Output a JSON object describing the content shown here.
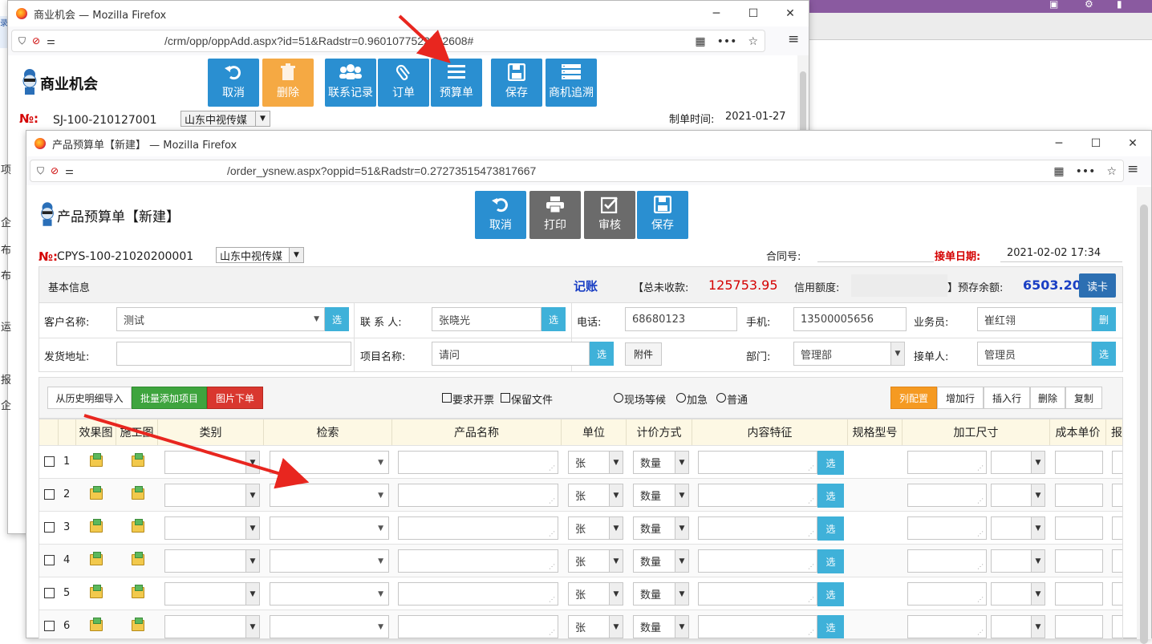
{
  "back_window": {
    "title": "商业机会 — Mozilla Firefox",
    "url": "/crm/opp/oppAdd.aspx?id=51&Radstr=0.9601077522582608#",
    "logo_text": "商业机会",
    "toolbar": [
      {
        "label": "取消",
        "icon": "undo-icon",
        "color": "#2a8fd1"
      },
      {
        "label": "删除",
        "icon": "trash-icon",
        "color": "#f5a943"
      },
      {
        "label": "联系记录",
        "icon": "users-icon",
        "color": "#2a8fd1"
      },
      {
        "label": "订单",
        "icon": "paperclip-icon",
        "color": "#2a8fd1"
      },
      {
        "label": "预算单",
        "icon": "list-icon",
        "color": "#2a8fd1"
      },
      {
        "label": "保存",
        "icon": "floppy-icon",
        "color": "#2a8fd1"
      },
      {
        "label": "商机追溯",
        "icon": "server-icon",
        "color": "#2a8fd1"
      }
    ],
    "no_label": "№:",
    "no_value": "SJ-100-210127001",
    "company": "山东中视传媒",
    "date_label": "制单时间:",
    "date_value": "2021-01-27",
    "left_edge_chars": [
      "项",
      "企",
      "布",
      "布",
      "运",
      "报",
      "企"
    ]
  },
  "front_window": {
    "title": "产品预算单【新建】 — Mozilla Firefox",
    "url": "/order_ysnew.aspx?oppid=51&Radstr=0.27273515473817667",
    "logo_text": "产品预算单【新建】",
    "toolbar": [
      {
        "label": "取消",
        "icon": "undo-icon",
        "color": "#2a8fd1"
      },
      {
        "label": "打印",
        "icon": "printer-icon",
        "color": "#6b6b6b"
      },
      {
        "label": "审核",
        "icon": "check-icon",
        "color": "#6b6b6b"
      },
      {
        "label": "保存",
        "icon": "floppy-icon",
        "color": "#2a8fd1"
      }
    ],
    "no_label": "№:",
    "no_value": "CPYS-100-21020200001",
    "company": "山东中视传媒",
    "contract_label": "合同号:",
    "contract_value": "",
    "receive_date_label": "接单日期:",
    "receive_date_value": "2021-02-02 17:34",
    "info": {
      "basic_label": "基本信息",
      "account_label": "记账",
      "total_unreceived_label": "【总未收款:",
      "total_unreceived_value": "125753.95",
      "credit_label": "信用额度:",
      "credit_value": "",
      "prepay_label": "】预存余额:",
      "prepay_value": "6503.20",
      "read_card_label": "读卡"
    },
    "form": {
      "customer_label": "客户名称:",
      "customer_value": "测试",
      "contact_label": "联 系 人:",
      "contact_value": "张晓光",
      "phone_label": "电话:",
      "phone_value": "68680123",
      "mobile_label": "手机:",
      "mobile_value": "13500005656",
      "sales_label": "业务员:",
      "sales_value": "崔红翎",
      "address_label": "发货地址:",
      "address_value": "",
      "project_label": "项目名称:",
      "project_value": "请问",
      "attach_label": "附件",
      "dept_label": "部门:",
      "dept_value": "管理部",
      "receiver_label": "接单人:",
      "receiver_value": "管理员",
      "select_label": "选",
      "delete_label": "删"
    },
    "actions": {
      "import_history": "从历史明细导入",
      "batch_add": "批量添加项目",
      "image_order": "图片下单",
      "need_invoice": "要求开票",
      "keep_file": "保留文件",
      "onsite_wait": "现场等候",
      "urgent": "加急",
      "normal": "普通",
      "column_config": "列配置",
      "add_row": "增加行",
      "insert_row": "插入行",
      "delete_row": "删除",
      "copy_row": "复制"
    },
    "columns": [
      "效果图",
      "施工图",
      "类别",
      "检索",
      "产品名称",
      "单位",
      "计价方式",
      "内容特征",
      "规格型号",
      "加工尺寸",
      "成本单价",
      "报"
    ],
    "rows": [
      {
        "no": "1",
        "unit": "张",
        "pricing": "数量",
        "select": "选"
      },
      {
        "no": "2",
        "unit": "张",
        "pricing": "数量",
        "select": "选"
      },
      {
        "no": "3",
        "unit": "张",
        "pricing": "数量",
        "select": "选"
      },
      {
        "no": "4",
        "unit": "张",
        "pricing": "数量",
        "select": "选"
      },
      {
        "no": "5",
        "unit": "张",
        "pricing": "数量",
        "select": "选"
      },
      {
        "no": "6",
        "unit": "张",
        "pricing": "数量",
        "select": "选"
      }
    ]
  },
  "annotation_color": "#e8261f"
}
